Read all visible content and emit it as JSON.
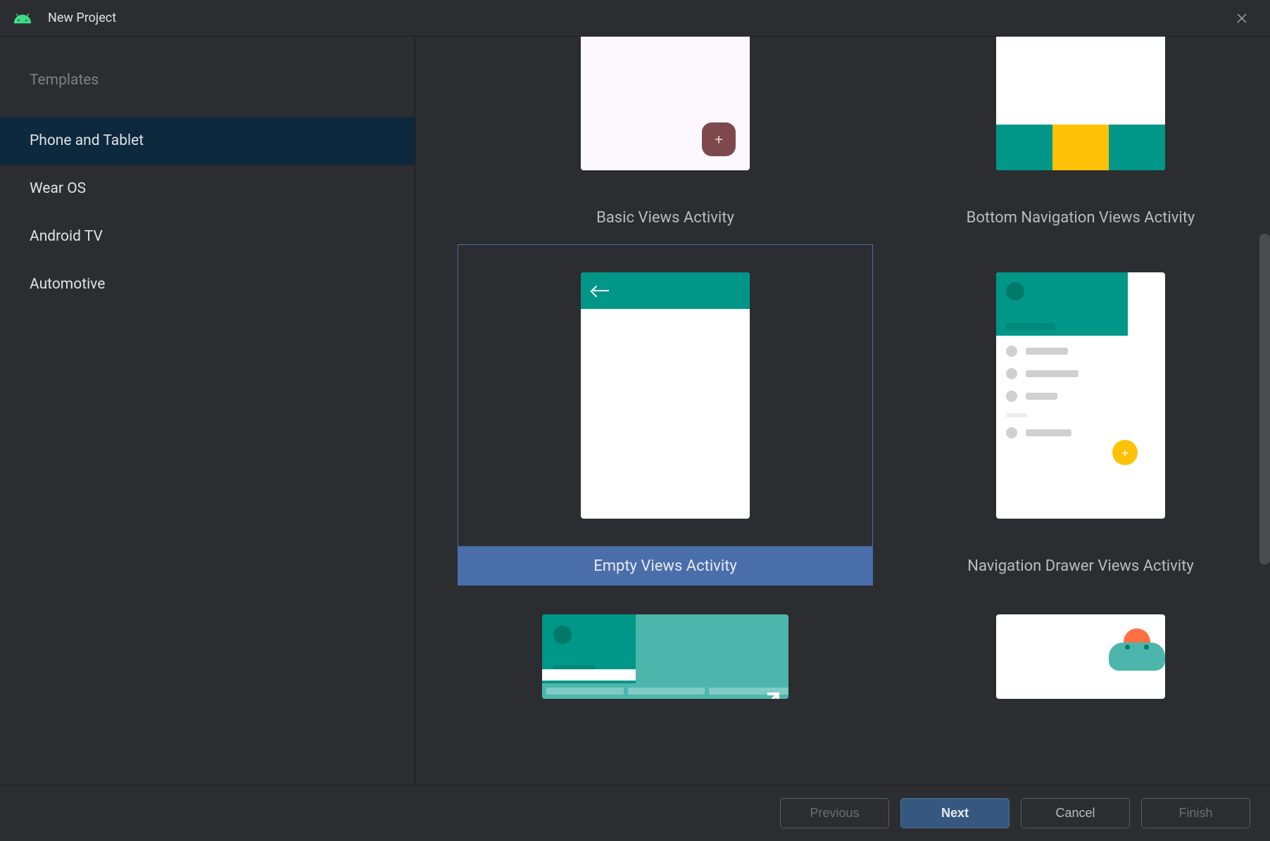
{
  "window": {
    "title": "New Project"
  },
  "sidebar": {
    "heading": "Templates",
    "items": [
      {
        "label": "Phone and Tablet",
        "active": true
      },
      {
        "label": "Wear OS",
        "active": false
      },
      {
        "label": "Android TV",
        "active": false
      },
      {
        "label": "Automotive",
        "active": false
      }
    ]
  },
  "templates": [
    {
      "id": "basic-views",
      "label": "Basic Views Activity",
      "selected": false
    },
    {
      "id": "bottom-nav-views",
      "label": "Bottom Navigation Views Activity",
      "selected": false
    },
    {
      "id": "empty-views",
      "label": "Empty Views Activity",
      "selected": true
    },
    {
      "id": "nav-drawer-views",
      "label": "Navigation Drawer Views Activity",
      "selected": false
    }
  ],
  "buttons": {
    "previous": "Previous",
    "next": "Next",
    "cancel": "Cancel",
    "finish": "Finish"
  },
  "colors": {
    "teal": "#009688",
    "accent_yellow": "#ffc107",
    "selection_blue": "#4a6ea9",
    "sidebar_active": "#0d293e"
  }
}
